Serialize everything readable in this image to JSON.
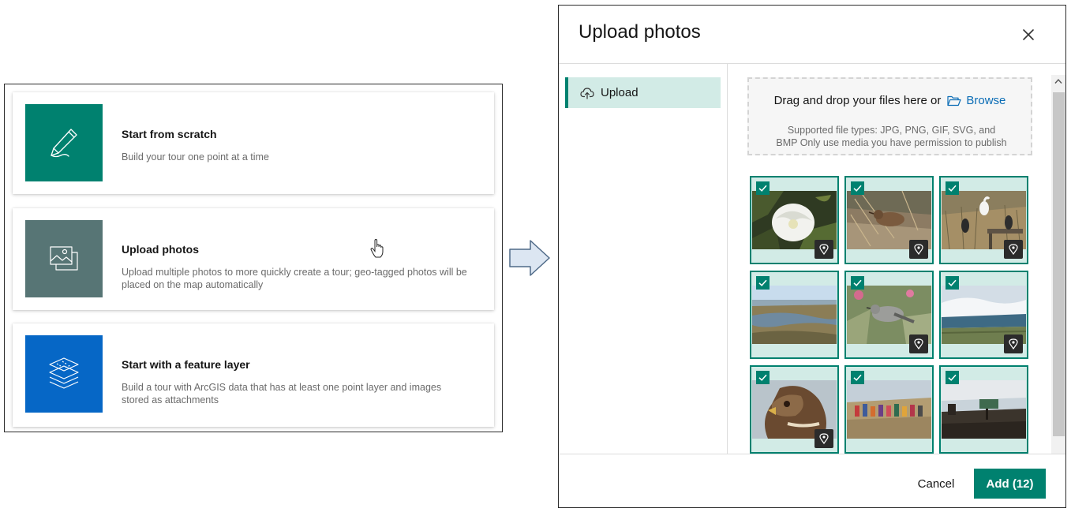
{
  "options": [
    {
      "title": "Start from scratch",
      "description": "Build your tour one point at a time",
      "icon": "pencil-icon",
      "tile_color": "#00816f"
    },
    {
      "title": "Upload photos",
      "description": "Upload multiple photos to more quickly create a tour; geo-tagged photos will be placed on the map automatically",
      "icon": "photos-icon",
      "tile_color": "#577575"
    },
    {
      "title": "Start with a feature layer",
      "description": "Build a tour with ArcGIS data that has at least one point layer and images stored as attachments",
      "icon": "layers-icon",
      "tile_color": "#0667c6"
    }
  ],
  "dialog": {
    "title": "Upload photos",
    "nav": [
      {
        "label": "Upload",
        "icon": "cloud-upload-icon",
        "selected": true
      }
    ],
    "dropzone": {
      "text": "Drag and drop your files here or",
      "browse_label": "Browse",
      "note_line1": "Supported file types: JPG, PNG, GIF, SVG, and",
      "note_line2": "BMP  Only use media you have permission to publish"
    },
    "photos": [
      {
        "subject": "white flower",
        "selected": true,
        "geotagged": true
      },
      {
        "subject": "bird in grass",
        "selected": true,
        "geotagged": true
      },
      {
        "subject": "egrets on fence",
        "selected": true,
        "geotagged": true
      },
      {
        "subject": "marsh landscape",
        "selected": true,
        "geotagged": false
      },
      {
        "subject": "mockingbird on plant",
        "selected": true,
        "geotagged": true
      },
      {
        "subject": "crashing wave",
        "selected": true,
        "geotagged": true
      },
      {
        "subject": "hawk portrait",
        "selected": true,
        "geotagged": true
      },
      {
        "subject": "group of hikers",
        "selected": true,
        "geotagged": false
      },
      {
        "subject": "trail sign at sunset",
        "selected": true,
        "geotagged": false
      }
    ],
    "footer": {
      "cancel_label": "Cancel",
      "add_label": "Add (12)"
    }
  },
  "colors": {
    "accent": "#00816f",
    "accent_light": "#d2ebe6",
    "link": "#0a6cb5"
  }
}
